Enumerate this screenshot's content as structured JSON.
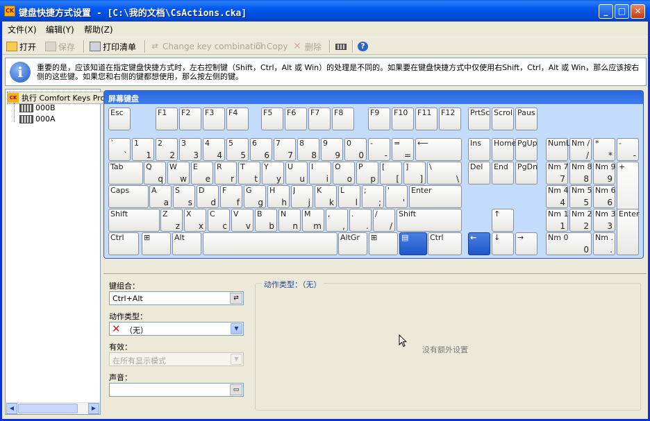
{
  "window": {
    "title": "键盘快捷方式设置 - [C:\\我的文档\\CsActions.cka]",
    "icon_label": "CK",
    "buttons": {
      "minimize": "_",
      "maximize": "□",
      "close": "✕"
    }
  },
  "menu": {
    "file": "文件(X)",
    "edit": "编辑(Y)",
    "help": "帮助(Z)"
  },
  "toolbar": {
    "open": "打开",
    "save": "保存",
    "print": "打印清单",
    "change_key": "Change key combination",
    "copy": "Copy",
    "delete": "删除"
  },
  "info": {
    "text": "重要的是，应该知道在指定键盘快捷方式时，左右控制键（Shift，Ctrl，Alt 或 Win）的处理是不同的。如果要在键盘快捷方式中仅使用右Shift，Ctrl，Alt 或 Win，那么应该按右侧的这些键。如果您和右侧的键都想使用，那么按左侧的键。"
  },
  "tree": {
    "root": "执行 Comfort Keys Pro",
    "root_icon": "CK",
    "children": [
      "000B",
      "000A"
    ]
  },
  "keyboard": {
    "title": "屏幕键盘",
    "keys": [
      {
        "t": "Esc",
        "b": ""
      },
      {
        "t": "F1",
        "b": ""
      },
      {
        "t": "F2",
        "b": ""
      },
      {
        "t": "F3",
        "b": ""
      },
      {
        "t": "F4",
        "b": ""
      },
      {
        "t": "F5",
        "b": ""
      },
      {
        "t": "F6",
        "b": ""
      },
      {
        "t": "F7",
        "b": ""
      },
      {
        "t": "F8",
        "b": ""
      },
      {
        "t": "F9",
        "b": ""
      },
      {
        "t": "F10",
        "b": ""
      },
      {
        "t": "F11",
        "b": ""
      },
      {
        "t": "F12",
        "b": ""
      },
      {
        "t": "PrtSc",
        "b": ""
      },
      {
        "t": "Scrol",
        "b": ""
      },
      {
        "t": "Paus",
        "b": ""
      },
      {
        "t": "`",
        "b": "`"
      },
      {
        "t": "1",
        "b": "1"
      },
      {
        "t": "2",
        "b": "2"
      },
      {
        "t": "3",
        "b": "3"
      },
      {
        "t": "4",
        "b": "4"
      },
      {
        "t": "5",
        "b": "5"
      },
      {
        "t": "6",
        "b": "6"
      },
      {
        "t": "7",
        "b": "7"
      },
      {
        "t": "8",
        "b": "8"
      },
      {
        "t": "9",
        "b": "9"
      },
      {
        "t": "0",
        "b": "0"
      },
      {
        "t": "-",
        "b": "-"
      },
      {
        "t": "=",
        "b": "="
      },
      {
        "t": "⟵",
        "b": ""
      },
      {
        "t": "Ins",
        "b": ""
      },
      {
        "t": "Home",
        "b": ""
      },
      {
        "t": "PgUp",
        "b": ""
      },
      {
        "t": "NumL",
        "b": ""
      },
      {
        "t": "Nm /",
        "b": "/"
      },
      {
        "t": "*",
        "b": "*"
      },
      {
        "t": "-",
        "b": "-"
      },
      {
        "t": "Tab",
        "b": ""
      },
      {
        "t": "Q",
        "b": "q"
      },
      {
        "t": "W",
        "b": "w"
      },
      {
        "t": "E",
        "b": "e"
      },
      {
        "t": "R",
        "b": "r"
      },
      {
        "t": "T",
        "b": "t"
      },
      {
        "t": "Y",
        "b": "y"
      },
      {
        "t": "U",
        "b": "u"
      },
      {
        "t": "I",
        "b": "i"
      },
      {
        "t": "O",
        "b": "o"
      },
      {
        "t": "P",
        "b": "p"
      },
      {
        "t": "[",
        "b": "["
      },
      {
        "t": "]",
        "b": "]"
      },
      {
        "t": "\\",
        "b": "\\"
      },
      {
        "t": "Del",
        "b": ""
      },
      {
        "t": "End",
        "b": ""
      },
      {
        "t": "PgDn",
        "b": ""
      },
      {
        "t": "Nm 7",
        "b": "7"
      },
      {
        "t": "Nm 8",
        "b": "8"
      },
      {
        "t": "Nm 9",
        "b": "9"
      },
      {
        "t": "+",
        "b": "+"
      },
      {
        "t": "Caps",
        "b": ""
      },
      {
        "t": "A",
        "b": "a"
      },
      {
        "t": "S",
        "b": "s"
      },
      {
        "t": "D",
        "b": "d"
      },
      {
        "t": "F",
        "b": "f"
      },
      {
        "t": "G",
        "b": "g"
      },
      {
        "t": "H",
        "b": "h"
      },
      {
        "t": "J",
        "b": "j"
      },
      {
        "t": "K",
        "b": "k"
      },
      {
        "t": "L",
        "b": "l"
      },
      {
        "t": ";",
        "b": ";"
      },
      {
        "t": "'",
        "b": "'"
      },
      {
        "t": "Enter",
        "b": ""
      },
      {
        "t": "Nm 4",
        "b": "4"
      },
      {
        "t": "Nm 5",
        "b": "5"
      },
      {
        "t": "Nm 6",
        "b": "6"
      },
      {
        "t": "Shift",
        "b": ""
      },
      {
        "t": "Z",
        "b": "z"
      },
      {
        "t": "X",
        "b": "x"
      },
      {
        "t": "C",
        "b": "c"
      },
      {
        "t": "V",
        "b": "v"
      },
      {
        "t": "B",
        "b": "b"
      },
      {
        "t": "N",
        "b": "n"
      },
      {
        "t": "M",
        "b": "m"
      },
      {
        "t": ",",
        "b": ","
      },
      {
        "t": ".",
        "b": "."
      },
      {
        "t": "/",
        "b": "/"
      },
      {
        "t": "Shift",
        "b": ""
      },
      {
        "t": "↑",
        "b": ""
      },
      {
        "t": "Nm 1",
        "b": "1"
      },
      {
        "t": "Nm 2",
        "b": "2"
      },
      {
        "t": "Nm 3",
        "b": "3"
      },
      {
        "t": "Enter",
        "b": ""
      },
      {
        "t": "Ctrl",
        "b": ""
      },
      {
        "t": "⊞",
        "b": ""
      },
      {
        "t": "Alt",
        "b": ""
      },
      {
        "t": "",
        "b": ""
      },
      {
        "t": "AltGr",
        "b": ""
      },
      {
        "t": "⊞",
        "b": ""
      },
      {
        "t": "▤",
        "b": ""
      },
      {
        "t": "Ctrl",
        "b": ""
      },
      {
        "t": "←",
        "b": ""
      },
      {
        "t": "↓",
        "b": ""
      },
      {
        "t": "→",
        "b": ""
      },
      {
        "t": "Nm 0",
        "b": "0"
      },
      {
        "t": "Nm .",
        "b": "."
      }
    ]
  },
  "form": {
    "combo_label": "键组合：",
    "combo_value": "Ctrl+Alt",
    "action_label": "动作类型：",
    "action_value": "（无）",
    "valid_label": "有效：",
    "valid_value": "在所有显示模式",
    "sound_label": "声音：",
    "sound_value": "",
    "group_title": "动作类型：（无）",
    "no_settings": "没有额外设置"
  }
}
